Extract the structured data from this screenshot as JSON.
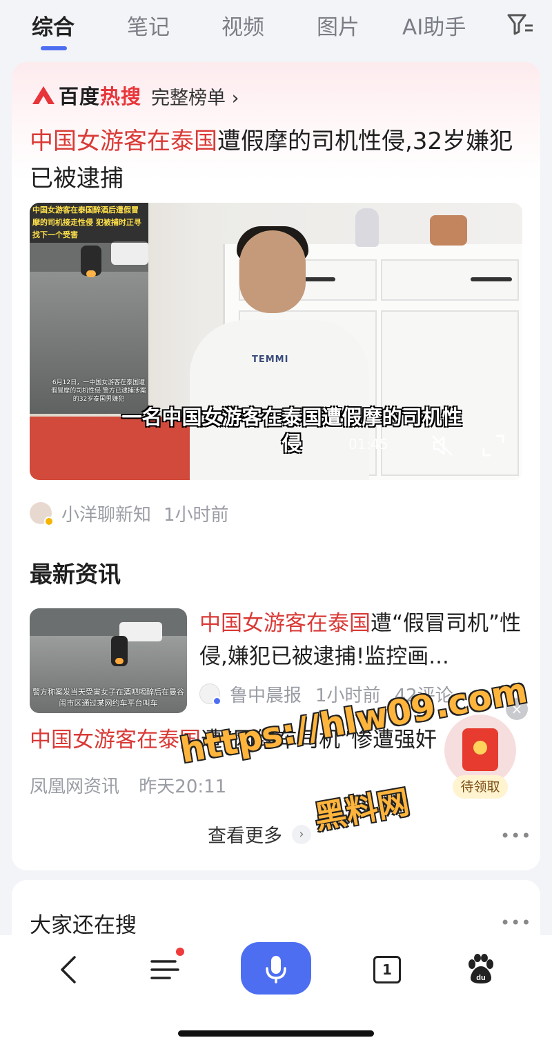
{
  "tabs": [
    {
      "label": "综合",
      "active": true
    },
    {
      "label": "笔记",
      "active": false
    },
    {
      "label": "视频",
      "active": false
    },
    {
      "label": "图片",
      "active": false
    },
    {
      "label": "AI助手",
      "active": false
    }
  ],
  "hot_search": {
    "brand_part1": "百度",
    "brand_part2": "热搜",
    "full_list_label": "完整榜单 ›",
    "headline_highlight": "中国女游客在泰国",
    "headline_rest": "遭假摩的司机性侵,32岁嫌犯已被逮捕"
  },
  "video": {
    "inset_caption": "中国女游客在泰国醉酒后遭假冒摩的司机接走性侵 犯被捕时正寻找下一个受害",
    "inset_sub": "6月12日，一中国女游客在泰国遭假冒摩的司机性侵 警方已逮捕涉案的32岁泰国男嫌犯",
    "shirt_text": "TEMMI",
    "subtitle": "一名中国女游客在泰国遭假摩的司机性侵",
    "duration": "01:45"
  },
  "author": {
    "name": "小洋聊新知",
    "time": "1小时前"
  },
  "latest_news": {
    "section_title": "最新资讯",
    "item1": {
      "title_highlight": "中国女游客在泰国",
      "title_rest": "遭“假冒司机”性侵,嫌犯已被逮捕!监控画...",
      "thumb_caption": "警方称案发当天受害女子在酒吧喝醉后在曼谷闹市区通过某网约车平台叫车",
      "source": "鲁中晨报",
      "time": "1小时前",
      "comments": "42评论"
    },
    "item2": {
      "title_highlight": "中国女游客在泰国",
      "title_rest": "遭“网约车司机”惨遭强奸",
      "source": "凤凰网资讯",
      "time": "昨天20:11"
    },
    "more_label": "查看更多",
    "more_dots": "•••"
  },
  "second_card": {
    "title": "大家还在搜",
    "dots": "•••"
  },
  "float_widget": {
    "close": "×",
    "label": "待领取"
  },
  "watermark": {
    "line1": "https://hlw09.com",
    "line2": "黑料网"
  },
  "bottom_bar": {
    "tab_count": "1"
  },
  "colors": {
    "accent": "#4e6ef2",
    "highlight_red": "#d93a36",
    "muted_gray": "#9a9da4"
  }
}
